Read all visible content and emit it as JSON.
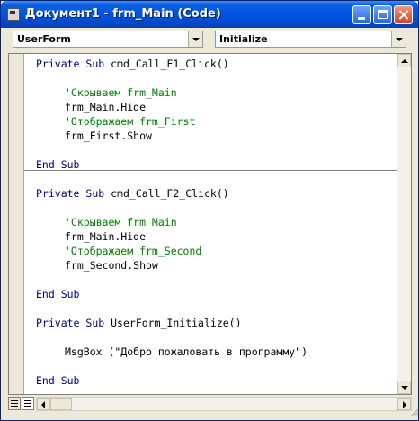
{
  "window": {
    "title": "Документ1 - frm_Main (Code)"
  },
  "object_combo": {
    "value": "UserForm"
  },
  "procedure_combo": {
    "value": "Initialize"
  },
  "code": {
    "sub1": {
      "kw_private": "Private",
      "kw_sub": "Sub",
      "name": "cmd_Call_F1_Click()",
      "comment1": "'Скрываем frm_Main",
      "stmt1": "frm_Main.Hide",
      "comment2": "'Отображаем frm_First",
      "stmt2": "frm_First.Show",
      "end": "End Sub"
    },
    "sub2": {
      "kw_private": "Private",
      "kw_sub": "Sub",
      "name": "cmd_Call_F2_Click()",
      "comment1": "'Скрываем frm_Main",
      "stmt1": "frm_Main.Hide",
      "comment2": "'Отображаем frm_Second",
      "stmt2": "frm_Second.Show",
      "end": "End Sub"
    },
    "sub3": {
      "kw_private": "Private",
      "kw_sub": "Sub",
      "name": "UserForm_Initialize()",
      "stmt1": "MsgBox (\"Добро пожаловать в программу\")",
      "end": "End Sub"
    }
  },
  "colors": {
    "keyword": "#00007f",
    "comment": "#007f00",
    "title_bar": "#0054e3"
  }
}
